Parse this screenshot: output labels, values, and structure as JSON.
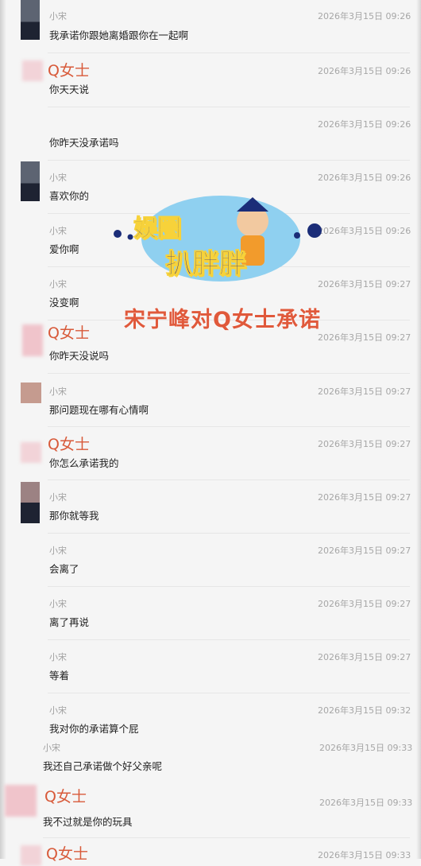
{
  "messages": [
    {
      "sender": "小宋",
      "time": "2026年3月15日 09:26",
      "text": "我承诺你跟她离婚跟你在一起啊"
    },
    {
      "sender": "Q女士",
      "time": "2026年3月15日 09:26",
      "text": "你天天说"
    },
    {
      "sender": "",
      "time": "2026年3月15日 09:26",
      "text": "你昨天没承诺吗"
    },
    {
      "sender": "小宋",
      "time": "2026年3月15日 09:26",
      "text": "喜欢你的"
    },
    {
      "sender": "小宋",
      "time": "2026年3月15日 09:26",
      "text": "爱你啊"
    },
    {
      "sender": "小宋",
      "time": "2026年3月15日 09:27",
      "text": "没变啊"
    },
    {
      "sender": "Q女士",
      "time": "2026年3月15日 09:27",
      "text": "你昨天没说吗"
    },
    {
      "sender": "小宋",
      "time": "2026年3月15日 09:27",
      "text": "那问题现在哪有心情啊"
    },
    {
      "sender": "Q女士",
      "time": "2026年3月15日 09:27",
      "text": "你怎么承诺我的"
    },
    {
      "sender": "小宋",
      "time": "2026年3月15日 09:27",
      "text": "那你就等我"
    },
    {
      "sender": "小宋",
      "time": "2026年3月15日 09:27",
      "text": "会离了"
    },
    {
      "sender": "小宋",
      "time": "2026年3月15日 09:27",
      "text": "离了再说"
    },
    {
      "sender": "小宋",
      "time": "2026年3月15日 09:27",
      "text": "等着"
    },
    {
      "sender": "小宋",
      "time": "2026年3月15日 09:32",
      "text": "我对你的承诺算个屁"
    },
    {
      "sender": "小宋",
      "time": "2026年3月15日 09:33",
      "text": "我还自己承诺做个好父亲呢"
    },
    {
      "sender": "Q女士",
      "time": "2026年3月15日 09:33",
      "text": "我不过就是你的玩具"
    },
    {
      "sender": "Q女士",
      "time": "2026年3月15日 09:33",
      "text": ""
    }
  ],
  "watermark": {
    "logo_line1": "娱圈",
    "logo_line2": "扒胖胖",
    "title": "宋宁峰对Q女士承诺"
  },
  "colors": {
    "background": "#f5f5f5",
    "sender_name_q": "#d85a3a",
    "watermark_title": "#e0593b"
  }
}
